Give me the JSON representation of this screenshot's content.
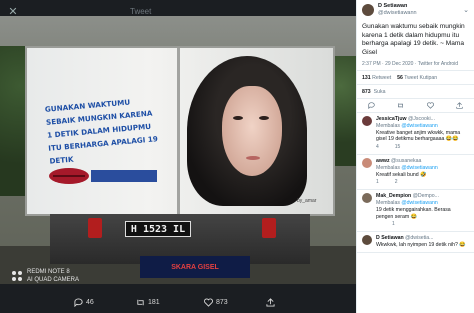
{
  "viewer": {
    "title": "Tweet",
    "truck_slogan": "Gunakan waktumu sebaik mungkin karena 1 detik dalam hidupmu itu berharga apalagi 19 detik",
    "plate": "H 1523 IL",
    "mudflap_text": "SKARA GISEL",
    "signature": "by_amar",
    "camera_tag": [
      "REDMI NOTE 8",
      "AI QUAD CAMERA"
    ],
    "actions": {
      "replies": "46",
      "retweets": "181",
      "likes": "873"
    }
  },
  "tweet": {
    "author_name": "D Setiawan",
    "author_handle": "@dwisetiawann",
    "text": "Gunakan waktumu sebaik mungkin karena 1 detik dalam hidupmu itu berharga apalagi 19 detik. ~ Mama Gisel",
    "meta": "2:37 PM · 29 Dec 2020 · Twitter for Android",
    "retweets_count": "131",
    "retweets_label": "Retweet",
    "quotes_count": "56",
    "quotes_label": "Tweet Kutipan",
    "likes_count": "873",
    "likes_label": "Suka"
  },
  "replies": [
    {
      "name": "JessicaTjuw",
      "handle": "@Jscooki...",
      "replying_prefix": "Membalas",
      "replying_to": "@dwisetiawann",
      "text": "Kreative banget anjim wkwkk, mama gisel 19 detikmu berhargaaaa 😂😂",
      "stats": [
        "4",
        "",
        "15"
      ]
    },
    {
      "name": "awwz",
      "handle": "@susanekaa",
      "replying_prefix": "Membalas",
      "replying_to": "@dwisetiawann",
      "text": "Kreatif sekali bund 🤣",
      "stats": [
        "1",
        "",
        "2"
      ]
    },
    {
      "name": "Mak_Dempion",
      "handle": "@Dempo...",
      "replying_prefix": "Membalas",
      "replying_to": "@dwisetiawann",
      "text": "19 detik menggairahkan. Berasa pengen seram 😂",
      "stats": [
        "",
        "",
        "1"
      ]
    },
    {
      "name": "D Setiawan",
      "handle": "@dwisetia...",
      "replying_prefix": "",
      "replying_to": "",
      "text": "Wkwkwk, lah nyimpen 19 detik nih? 😂",
      "stats": [
        "",
        "",
        ""
      ]
    }
  ]
}
